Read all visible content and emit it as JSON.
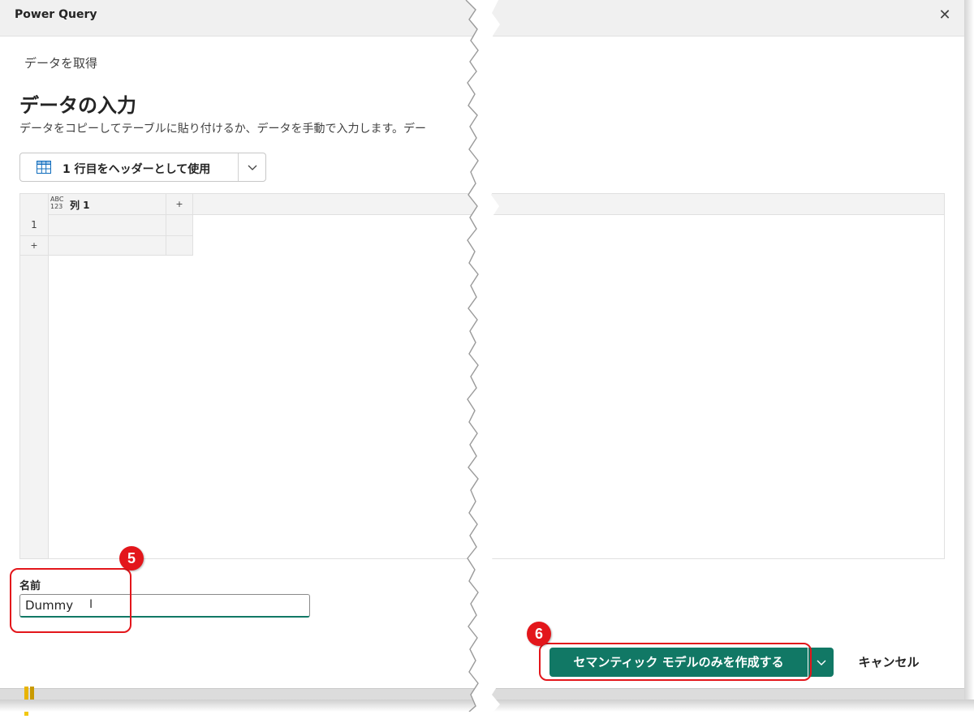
{
  "window": {
    "title": "Power Query",
    "close_icon": "close-icon"
  },
  "breadcrumb": "データを取得",
  "page": {
    "title": "データの入力",
    "description": "データをコピーしてテーブルに貼り付けるか、データを手動で入力します。デー"
  },
  "toolbar": {
    "header_toggle_label": "1 行目をヘッダーとして使用",
    "header_toggle_icon": "table-icon",
    "dropdown_icon": "chevron-down-icon"
  },
  "grid": {
    "type_icon_top": "ABC",
    "type_icon_bottom": "123",
    "columns": [
      "列 1"
    ],
    "add_column_label": "+",
    "rows": [
      {
        "num": "1",
        "cells": [
          ""
        ]
      }
    ],
    "add_row_label": "+"
  },
  "name_field": {
    "label": "名前",
    "value": "Dummy"
  },
  "footer": {
    "create_label": "セマンティック モデルのみを作成する",
    "create_dropdown_icon": "chevron-down-icon",
    "cancel_label": "キャンセル"
  },
  "annotations": {
    "step5": "5",
    "step6": "6",
    "color": "#e3161b"
  },
  "colors": {
    "accent": "#117865",
    "titlebar": "#f0f0f0"
  }
}
